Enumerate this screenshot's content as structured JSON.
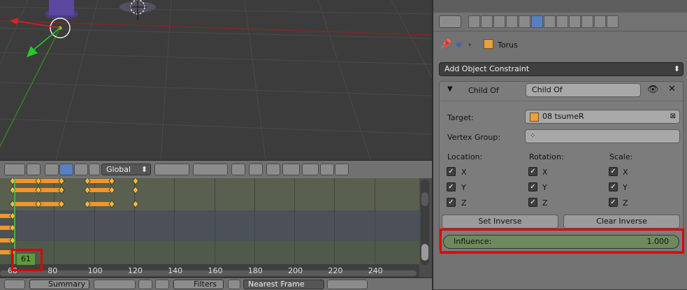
{
  "viewport": {
    "orientation": "3d-viewport-grid"
  },
  "viewport_header": {
    "orientation_select": "Global"
  },
  "dopesheet": {
    "current_frame": "61",
    "frame_ticks": [
      "60",
      "80",
      "100",
      "120",
      "140",
      "160",
      "180",
      "200",
      "220",
      "240"
    ],
    "footer": {
      "mode_select": "Summary",
      "filters_label": "Filters",
      "snap_select": "Nearest Frame"
    }
  },
  "properties": {
    "breadcrumb_object": "Torus",
    "add_constraint_label": "Add Object Constraint",
    "constraint": {
      "type_label": "Child Of",
      "name_value": "Child Of",
      "target_label": "Target:",
      "target_value": "08 tsumeR",
      "vertex_group_label": "Vertex Group:",
      "location_label": "Location:",
      "rotation_label": "Rotation:",
      "scale_label": "Scale:",
      "axes": [
        "X",
        "Y",
        "Z"
      ],
      "set_inverse_label": "Set Inverse",
      "clear_inverse_label": "Clear Inverse",
      "influence_label": "Influence:",
      "influence_value": "1.000"
    }
  },
  "colors": {
    "keyframe_orange": "#f0962a",
    "influence_green": "#6e8a5c",
    "highlight_red": "#e00000",
    "current_frame_green": "#5d9a3a"
  }
}
